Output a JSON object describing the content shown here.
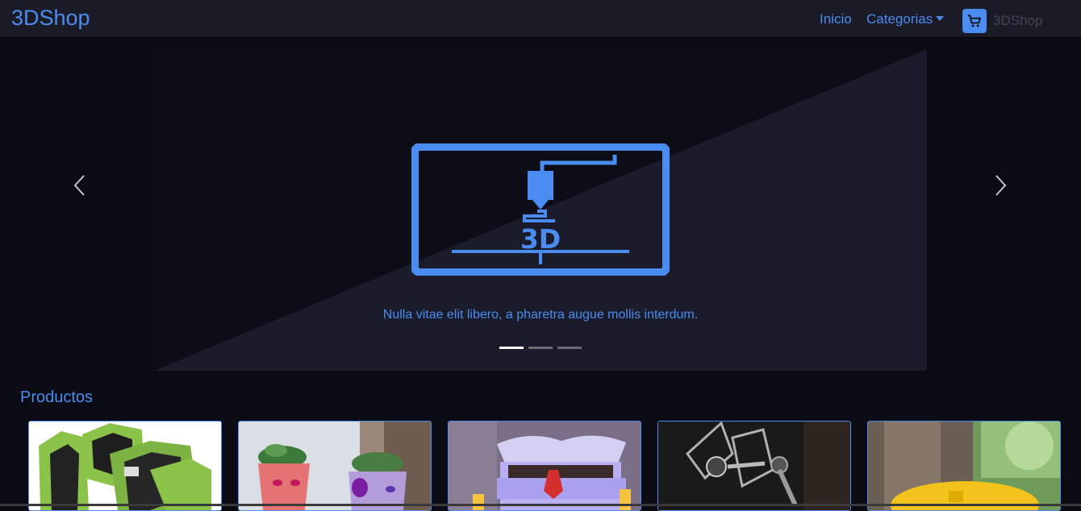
{
  "navbar": {
    "brand": "3DShop",
    "links": {
      "inicio": "Inicio",
      "categorias": "Categorias"
    },
    "cart_icon": "cart-icon",
    "cart_label": "3DShop"
  },
  "carousel": {
    "logo_text": "3D",
    "caption": "Nulla vitae elit libero, a pharetra augue mollis interdum.",
    "slide_count": 3,
    "active_slide": 1,
    "prev_icon": "chevron-left-icon",
    "next_icon": "chevron-right-icon"
  },
  "products": {
    "title": "Productos",
    "items": [
      {
        "image": "green-hexagon-cable-organizer"
      },
      {
        "image": "face-planter-pots"
      },
      {
        "image": "cartoon-box-with-tie"
      },
      {
        "image": "tie-fighter-model"
      },
      {
        "image": "yellow-bird-house-on-tree"
      }
    ]
  },
  "colors": {
    "accent": "#4a8cf0",
    "navbar_bg": "#1a1b26",
    "page_bg": "#0b0b14"
  }
}
